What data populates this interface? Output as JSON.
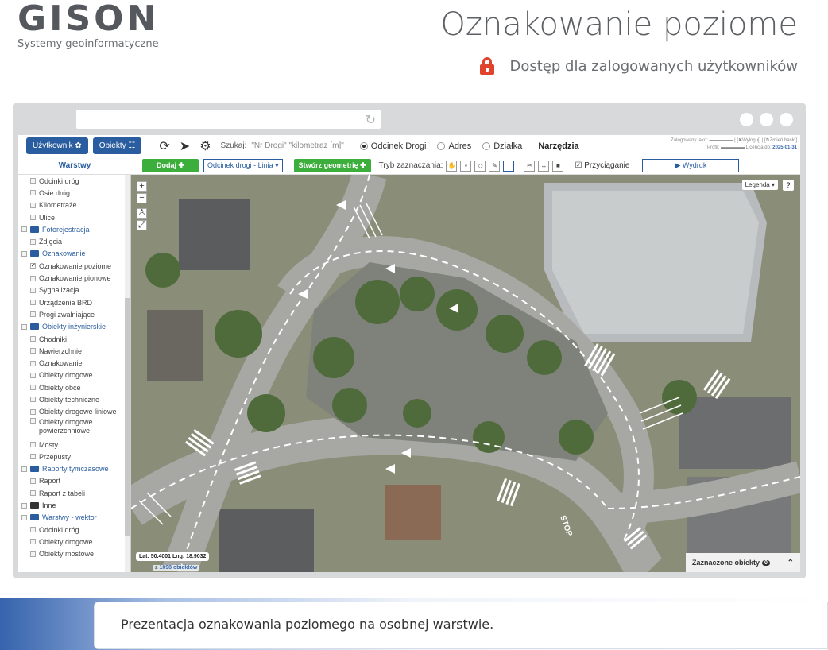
{
  "header": {
    "logo": "GISON",
    "tagline": "Systemy geoinformatyczne",
    "title": "Oznakowanie poziome",
    "access_text": "Dostęp dla zalogowanych użytkowników",
    "access_icon": "lock-icon"
  },
  "toolbar": {
    "user_btn": "Użytkownik ✿",
    "objects_btn": "Obiekty ☷",
    "search_label": "Szukaj:",
    "search_placeholder": "\"Nr Drogi\" \"kilometraz [m]\"",
    "radio_segment": "Odcinek Drogi",
    "radio_address": "Adres",
    "radio_parcel": "Działka",
    "tools_label": "Narzędzia",
    "user_line1": "Zalogowany jako: ▬▬▬▬▬ | [✖Wyloguj] | [↻Zmień hasło]",
    "user_line2": "Profil: ▬▬▬▬▬ Licencja do: ",
    "license_date": "2025-01-31"
  },
  "toolbar2": {
    "layers_title": "Warstwy",
    "add_btn": "Dodaj ✚",
    "layer_select": "Odcinek drogi - Linia ▾",
    "create_btn": "Stwórz geometrię ✚",
    "mode_label": "Tryb zaznaczania:",
    "snap_label": "Przyciąganie",
    "print_btn": "▶ Wydruk"
  },
  "sidebar": {
    "items": [
      {
        "label": "Odcinki dróg",
        "type": "sub"
      },
      {
        "label": "Osie dróg",
        "type": "sub"
      },
      {
        "label": "Kilometraże",
        "type": "sub"
      },
      {
        "label": "Ulice",
        "type": "sub"
      },
      {
        "label": "Fotorejestracja",
        "type": "grp"
      },
      {
        "label": "Zdjęcia",
        "type": "sub"
      },
      {
        "label": "Oznakowanie",
        "type": "grp"
      },
      {
        "label": "Oznakowanie poziome",
        "type": "sub",
        "checked": true
      },
      {
        "label": "Oznakowanie pionowe",
        "type": "sub"
      },
      {
        "label": "Sygnalizacja",
        "type": "sub"
      },
      {
        "label": "Urządzenia BRD",
        "type": "sub"
      },
      {
        "label": "Progi zwalniające",
        "type": "sub"
      },
      {
        "label": "Obiekty inżynierskie",
        "type": "grp"
      },
      {
        "label": "Chodniki",
        "type": "sub"
      },
      {
        "label": "Nawierzchnie",
        "type": "sub"
      },
      {
        "label": "Oznakowanie",
        "type": "sub"
      },
      {
        "label": "Obiekty drogowe",
        "type": "sub"
      },
      {
        "label": "Obiekty obce",
        "type": "sub"
      },
      {
        "label": "Obiekty techniczne",
        "type": "sub"
      },
      {
        "label": "Obiekty drogowe liniowe",
        "type": "sub"
      },
      {
        "label": "Obiekty drogowe powierzchniowe",
        "type": "sub",
        "wrap": true
      },
      {
        "label": "Mosty",
        "type": "sub"
      },
      {
        "label": "Przepusty",
        "type": "sub"
      },
      {
        "label": "Raporty tymczasowe",
        "type": "grp"
      },
      {
        "label": "Raport",
        "type": "sub"
      },
      {
        "label": "Raport z tabeli",
        "type": "sub"
      },
      {
        "label": "Inne",
        "type": "grp",
        "dark": true
      },
      {
        "label": "Warstwy - wektor",
        "type": "grp"
      },
      {
        "label": "Odcinki dróg",
        "type": "sub"
      },
      {
        "label": "Obiekty drogowe",
        "type": "sub"
      },
      {
        "label": "Obiekty mostowe",
        "type": "sub"
      }
    ]
  },
  "map": {
    "legend": "Legenda ▾",
    "help": "?",
    "coords": "Lat: 50.4001 Lng: 18.9032",
    "count": "z 1098 obiektów",
    "selected_label": "Zaznaczone obiekty",
    "selected_count": "0",
    "stop_label": "STOP"
  },
  "caption": "Prezentacja oznakowania poziomego na osobnej warstwie."
}
